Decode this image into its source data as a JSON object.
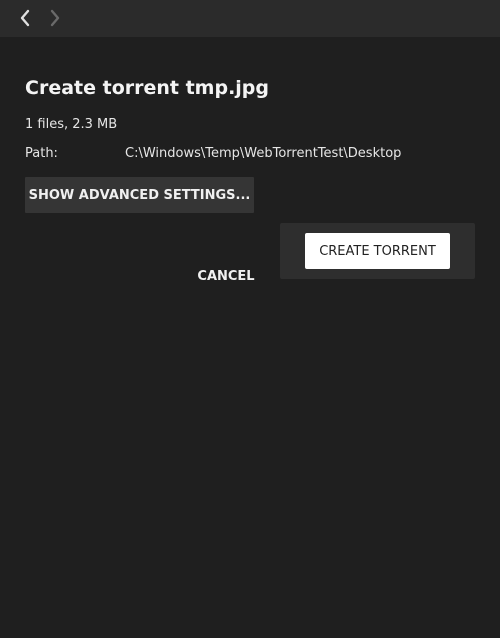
{
  "header": {
    "back_icon": "chevron-left-icon",
    "forward_icon": "chevron-right-icon"
  },
  "main": {
    "title": "Create torrent tmp.jpg",
    "info": "1 files, 2.3 MB",
    "path_label": "Path:",
    "path_value": "C:\\Windows\\Temp\\WebTorrentTest\\Desktop",
    "advanced_button": "SHOW ADVANCED SETTINGS...",
    "cancel_button": "CANCEL",
    "create_button": "CREATE TORRENT"
  },
  "colors": {
    "background": "#1f1f1f",
    "header": "#2b2b2b",
    "button_dark": "#353535",
    "button_primary": "#ffffff"
  }
}
